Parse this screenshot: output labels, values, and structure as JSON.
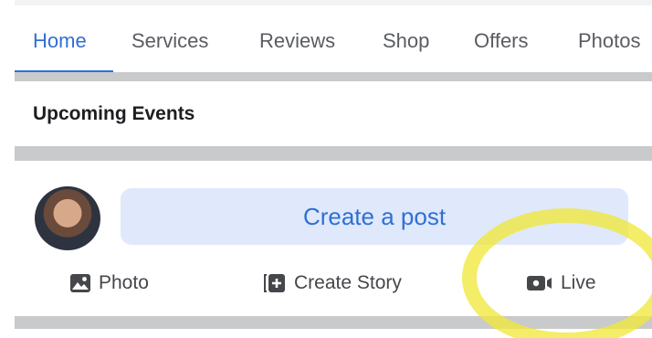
{
  "nav": {
    "tabs": [
      {
        "label": "Home"
      },
      {
        "label": "Services"
      },
      {
        "label": "Reviews"
      },
      {
        "label": "Shop"
      },
      {
        "label": "Offers"
      },
      {
        "label": "Photos"
      }
    ],
    "active_tab": "Home"
  },
  "upcoming_events": {
    "label": "Upcoming Events"
  },
  "composer": {
    "create_post_label": "Create a post",
    "actions": [
      {
        "label": "Photo",
        "icon": "photo-icon"
      },
      {
        "label": "Create Story",
        "icon": "create-story-icon"
      },
      {
        "label": "Live",
        "icon": "live-video-icon"
      }
    ]
  },
  "colors": {
    "accent": "#2f6fd6",
    "create_post_bg": "#dfe9fb",
    "highlight": "#f0e83c"
  }
}
